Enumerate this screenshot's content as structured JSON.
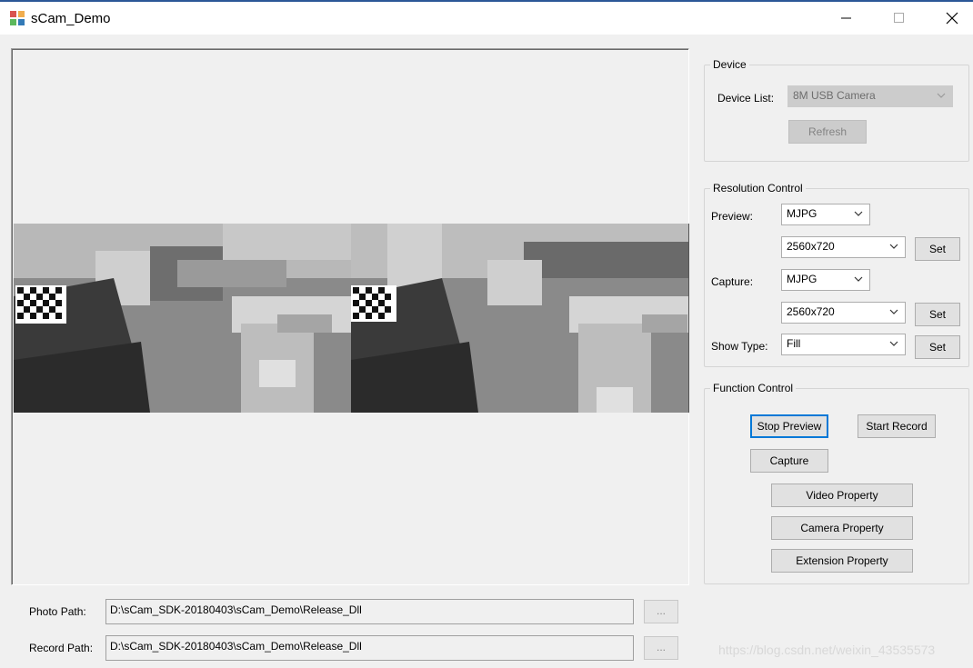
{
  "window": {
    "title": "sCam_Demo",
    "icons": [
      "app-icon",
      "minimize-icon",
      "maximize-icon",
      "close-icon"
    ]
  },
  "paths": {
    "photo_label": "Photo Path:",
    "photo_value": "D:\\sCam_SDK-20180403\\sCam_Demo\\Release_Dll",
    "record_label": "Record Path:",
    "record_value": "D:\\sCam_SDK-20180403\\sCam_Demo\\Release_Dll",
    "browse_label": "..."
  },
  "device": {
    "title": "Device",
    "list_label": "Device List:",
    "list_value": "8M USB Camera",
    "refresh_label": "Refresh"
  },
  "resolution": {
    "title": "Resolution Control",
    "preview_label": "Preview:",
    "preview_format": "MJPG",
    "preview_size": "2560x720",
    "capture_label": "Capture:",
    "capture_format": "MJPG",
    "capture_size": "2560x720",
    "show_type_label": "Show Type:",
    "show_type_value": "Fill",
    "set_label": "Set"
  },
  "function": {
    "title": "Function Control",
    "stop_preview": "Stop Preview",
    "start_record": "Start Record",
    "capture": "Capture",
    "video_property": "Video Property",
    "camera_property": "Camera Property",
    "extension_property": "Extension Property"
  },
  "watermark": "https://blog.csdn.net/weixin_43535573"
}
